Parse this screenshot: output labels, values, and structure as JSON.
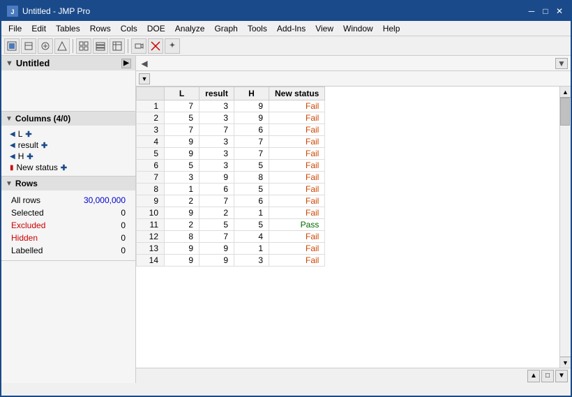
{
  "window": {
    "title": "Untitled - JMP Pro",
    "icon": "JMP"
  },
  "titlebar": {
    "minimize": "─",
    "maximize": "□",
    "close": "✕"
  },
  "menubar": {
    "items": [
      "File",
      "Edit",
      "Tables",
      "Rows",
      "Cols",
      "DOE",
      "Analyze",
      "Graph",
      "Tools",
      "Add-Ins",
      "View",
      "Window",
      "Help"
    ]
  },
  "left_panel": {
    "untitled_label": "Untitled",
    "columns_label": "Columns (4/0)",
    "columns": [
      {
        "name": "L",
        "icon": "triangle",
        "color": "blue",
        "plus": true
      },
      {
        "name": "result",
        "icon": "triangle",
        "color": "blue",
        "plus": true
      },
      {
        "name": "H",
        "icon": "triangle",
        "color": "blue",
        "plus": true
      },
      {
        "name": "New status",
        "icon": "bar",
        "color": "red",
        "plus": true
      }
    ],
    "rows_label": "Rows",
    "rows": {
      "all_rows_label": "All rows",
      "all_rows_value": "30,000,000",
      "selected_label": "Selected",
      "selected_value": "0",
      "excluded_label": "Excluded",
      "excluded_value": "0",
      "hidden_label": "Hidden",
      "hidden_value": "0",
      "labelled_label": "Labelled",
      "labelled_value": "0"
    }
  },
  "table": {
    "headers": [
      "L",
      "result",
      "H",
      "New status"
    ],
    "rows": [
      {
        "num": 1,
        "L": 7,
        "result": 3,
        "H": 9,
        "status": "Fail",
        "status_type": "fail"
      },
      {
        "num": 2,
        "L": 5,
        "result": 3,
        "H": 9,
        "status": "Fail",
        "status_type": "fail"
      },
      {
        "num": 3,
        "L": 7,
        "result": 7,
        "H": 6,
        "status": "Fail",
        "status_type": "fail"
      },
      {
        "num": 4,
        "L": 9,
        "result": 3,
        "H": 7,
        "status": "Fail",
        "status_type": "fail"
      },
      {
        "num": 5,
        "L": 9,
        "result": 3,
        "H": 7,
        "status": "Fail",
        "status_type": "fail"
      },
      {
        "num": 6,
        "L": 5,
        "result": 3,
        "H": 5,
        "status": "Fail",
        "status_type": "fail"
      },
      {
        "num": 7,
        "L": 3,
        "result": 9,
        "H": 8,
        "status": "Fail",
        "status_type": "fail"
      },
      {
        "num": 8,
        "L": 1,
        "result": 6,
        "H": 5,
        "status": "Fail",
        "status_type": "fail"
      },
      {
        "num": 9,
        "L": 2,
        "result": 7,
        "H": 6,
        "status": "Fail",
        "status_type": "fail"
      },
      {
        "num": 10,
        "L": 9,
        "result": 2,
        "H": 1,
        "status": "Fail",
        "status_type": "fail"
      },
      {
        "num": 11,
        "L": 2,
        "result": 5,
        "H": 5,
        "status": "Pass",
        "status_type": "pass"
      },
      {
        "num": 12,
        "L": 8,
        "result": 7,
        "H": 4,
        "status": "Fail",
        "status_type": "fail"
      },
      {
        "num": 13,
        "L": 9,
        "result": 9,
        "H": 1,
        "status": "Fail",
        "status_type": "fail"
      },
      {
        "num": 14,
        "L": 9,
        "result": 9,
        "H": 3,
        "status": "Fail",
        "status_type": "fail"
      }
    ]
  },
  "bottom_scroll": {
    "up_arrow": "▲",
    "box_arrow": "□",
    "down_arrow": "▼"
  }
}
